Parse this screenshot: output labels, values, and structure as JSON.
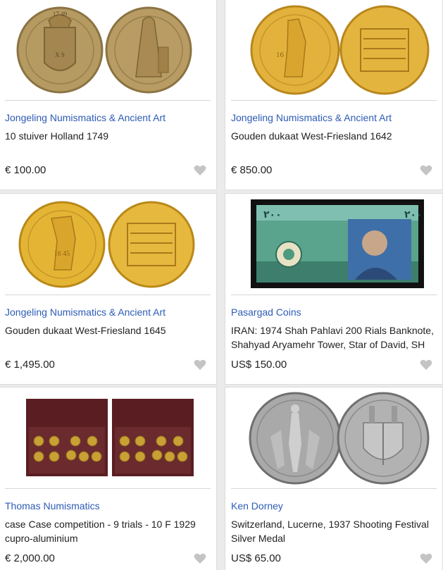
{
  "listings": [
    {
      "seller": "Jongeling Numismatics & Ancient Art",
      "title_line1": "10 stuiver Holland 1749",
      "title_line2": "",
      "price": "€ 100.00",
      "image": "silver-coins-holland",
      "coin_text_left": "17 49",
      "coin_text_left2": "X S",
      "colors": {
        "metal": "#b59a62",
        "metal_dark": "#8b7342"
      }
    },
    {
      "seller": "Jongeling Numismatics & Ancient Art",
      "title_line1": "Gouden dukaat West-Friesland 1642",
      "title_line2": "",
      "price": "€ 850.00",
      "image": "gold-ducat-1642",
      "coin_text_left": "16",
      "colors": {
        "metal": "#e2b23c",
        "metal_dark": "#b8861c"
      }
    },
    {
      "seller": "Jongeling Numismatics & Ancient Art",
      "title_line1": "Gouden dukaat West-Friesland 1645",
      "title_line2": "",
      "price": "€ 1,495.00",
      "image": "gold-ducat-1645",
      "coin_text_left": "16 45",
      "colors": {
        "metal": "#e4b535",
        "metal_dark": "#b98818"
      }
    },
    {
      "seller": "Pasargad Coins",
      "title_line1": "IRAN: 1974 Shah Pahlavi 200 Rials Banknote,",
      "title_line2": "Shahyad Aryamehr Tower, Star of David, SH",
      "price": "US$ 150.00",
      "image": "iran-200-rials-banknote",
      "note_value": "۲۰۰",
      "colors": {
        "note": "#3f8e7a",
        "frame": "#111111"
      }
    },
    {
      "seller": "Thomas Numismatics",
      "title_line1": "case Case competition - 9 trials - 10 F 1929",
      "title_line2": "cupro-aluminium",
      "price": "€ 2,000.00",
      "image": "coin-trial-cases",
      "colors": {
        "case": "#5a1e22",
        "coin": "#c9a034"
      }
    },
    {
      "seller": "Ken Dorney",
      "title_line1": "Switzerland, Lucerne, 1937 Shooting Festival",
      "title_line2": "Silver Medal",
      "price": "US$ 65.00",
      "image": "lucerne-silver-medal",
      "colors": {
        "metal": "#a9a9a9",
        "metal_dark": "#6f6f6f"
      }
    }
  ],
  "colors": {
    "link": "#2d5bb5",
    "heart": "#c4c4c4",
    "background": "#ebebeb"
  }
}
